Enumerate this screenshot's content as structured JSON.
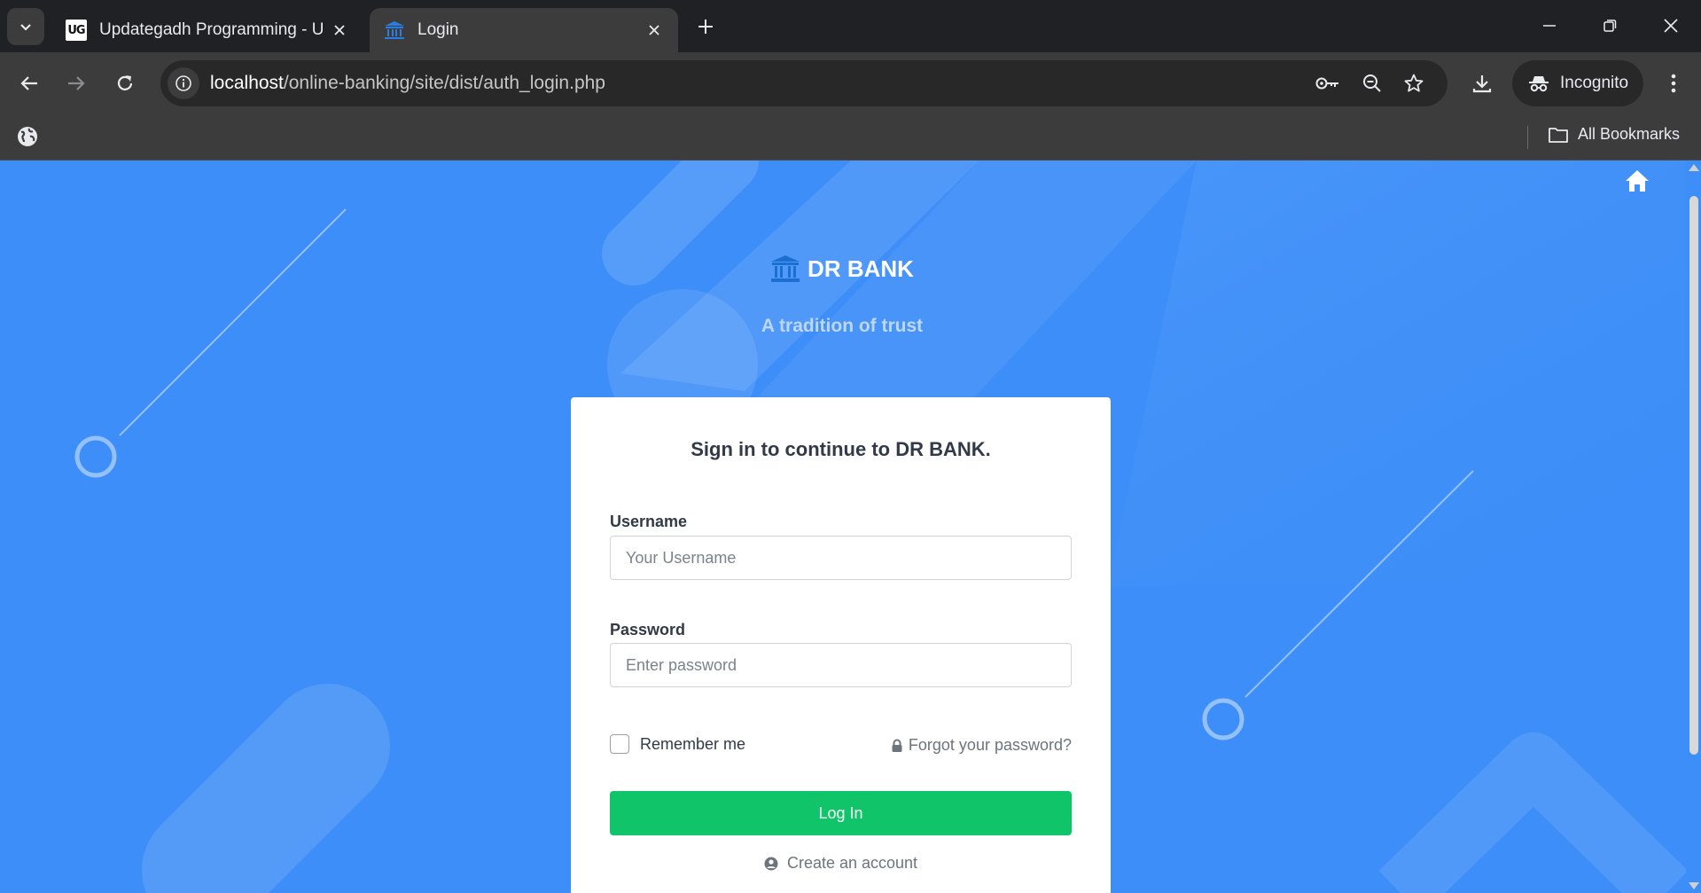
{
  "browser": {
    "tabs": [
      {
        "title": "Updategadh Programming - Updategadh",
        "icon": "updategadh-logo-icon",
        "favicon_text": "UG",
        "active": false
      },
      {
        "title": "Login",
        "icon": "bank-icon",
        "active": true
      }
    ],
    "url_host": "localhost",
    "url_path": "/online-banking/site/dist/auth_login.php",
    "incognito_label": "Incognito",
    "bookmarks_label": "All Bookmarks"
  },
  "page": {
    "brand_name": "DR BANK",
    "tagline": "A tradition of trust",
    "card_title": "Sign in to continue to DR BANK.",
    "username_label": "Username",
    "username_placeholder": "Your Username",
    "password_label": "Password",
    "password_placeholder": "Enter password",
    "remember_label": "Remember me",
    "forgot_label": "Forgot your password?",
    "login_label": "Log In",
    "create_label": "Create an account"
  },
  "colors": {
    "page_background": "#3d8ef8",
    "login_button": "#10c469",
    "brand_icon": "#1a6fd0",
    "card_text": "#313a46"
  }
}
